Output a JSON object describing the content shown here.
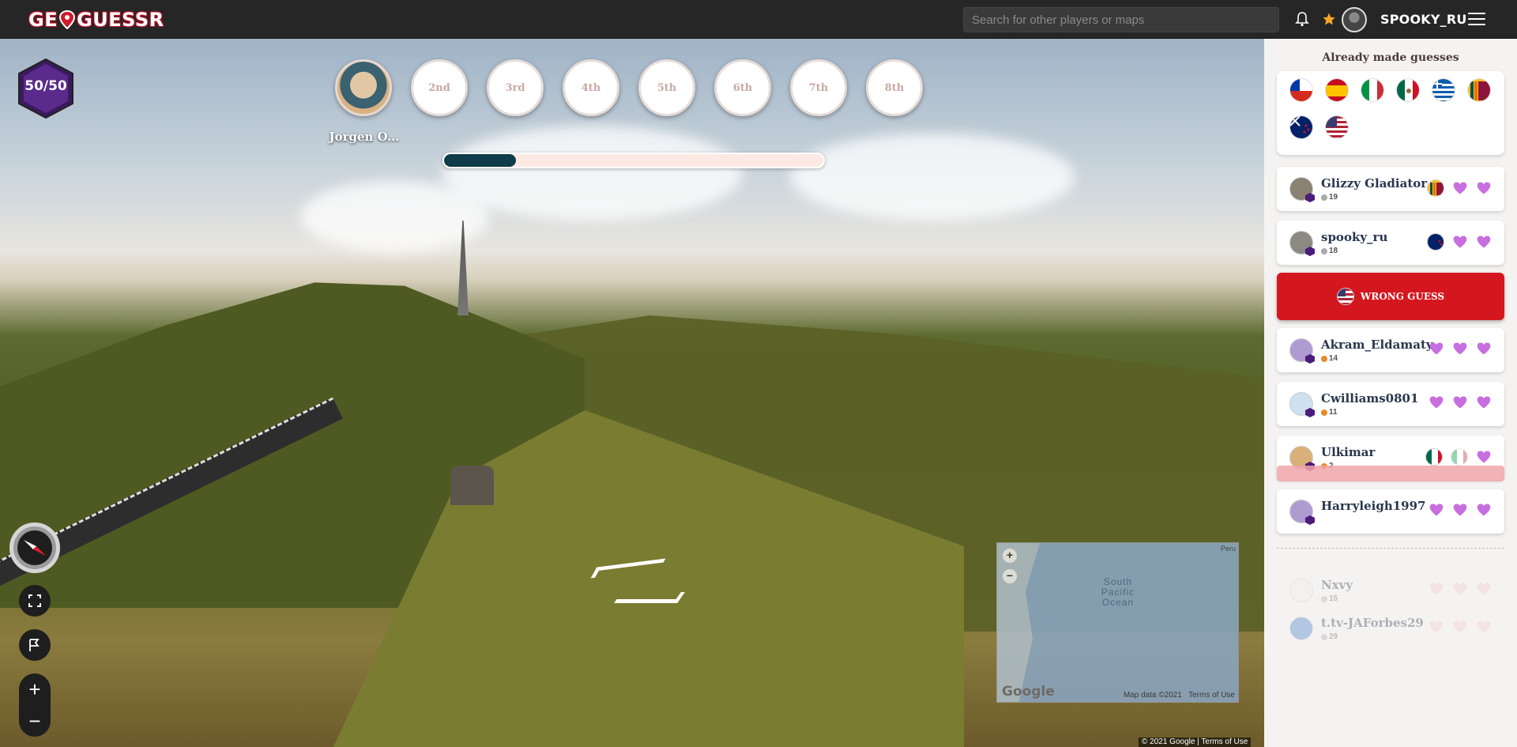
{
  "header": {
    "logo_text_left": "GE",
    "logo_text_right": "GUESSR",
    "search_placeholder": "Search for other players or maps",
    "username": "SPOOKY_RU"
  },
  "game": {
    "lives_label": "50/50",
    "ranks": [
      {
        "label": "",
        "player": "Jorgen O..."
      },
      {
        "label": "2nd"
      },
      {
        "label": "3rd"
      },
      {
        "label": "4th"
      },
      {
        "label": "5th"
      },
      {
        "label": "6th"
      },
      {
        "label": "7th"
      },
      {
        "label": "8th"
      }
    ],
    "timer_progress": 0.19
  },
  "minimap": {
    "ocean_label_1": "South",
    "ocean_label_2": "Pacific",
    "ocean_label_3": "Ocean",
    "peru_label": "Peru",
    "google_label": "Google",
    "map_data": "Map data ©2021",
    "terms": "Terms of Use"
  },
  "footer": {
    "copyright": "© 2021 Google",
    "terms": "Terms of Use"
  },
  "panel": {
    "title": "Already made guesses",
    "guessed_flags": [
      "chile",
      "spain",
      "italy",
      "mexico",
      "greece",
      "sri-lanka",
      "new-zealand",
      "usa"
    ],
    "players": [
      {
        "name": "Glizzy Gladiator",
        "score": "19",
        "flag": "sri-lanka",
        "hearts": 2
      },
      {
        "name": "spooky_ru",
        "score": "18",
        "flag": "new-zealand",
        "hearts": 2
      },
      {
        "name": "Akram_Eldamaty",
        "score": "14",
        "hearts": 3
      },
      {
        "name": "Cwilliams0801",
        "score": "11",
        "hearts": 3
      },
      {
        "name": "Ulkimar",
        "score": "2",
        "flag": "mexico",
        "hearts": 1
      },
      {
        "name": "Harryleigh1997",
        "score": "",
        "hearts": 3
      }
    ],
    "wrong_guess_label": "WRONG GUESS",
    "eliminated": [
      {
        "name": "Nxvy",
        "score": "15"
      },
      {
        "name": "t.tv-JAForbes29",
        "score": "29"
      }
    ]
  },
  "colors": {
    "accent_red": "#d4171f",
    "heart_purple": "#c86fe0",
    "progress_fill": "#0f3b4b",
    "badge_purple": "#4c1c7c"
  }
}
